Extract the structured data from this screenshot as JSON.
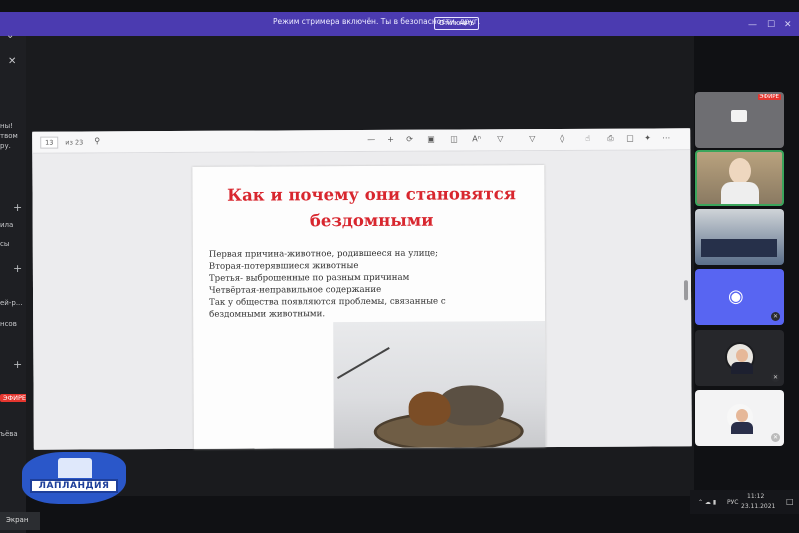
{
  "banner": {
    "text": "Режим стримера включён. Ты в безопасности, друг.",
    "disable_button": "Отключить"
  },
  "window_controls": {
    "minimize": "—",
    "maximize": "☐",
    "close": "✕"
  },
  "sidebar": {
    "chevron": "⌄",
    "close": "✕",
    "fragments": [
      "ны!",
      "твом",
      "ру.",
      "ила",
      "сы",
      "ей-р...",
      "нсов",
      "ъёва"
    ],
    "add": "+",
    "live_badge": "ЭФИРЕ",
    "screen_button": "Экран"
  },
  "pdf_viewer": {
    "page_current": "13",
    "page_total": "из 23",
    "toolbar_icons": [
      "search-icon",
      "zoom-out-icon",
      "zoom-in-icon",
      "rotate-icon",
      "fit-page-icon",
      "page-view-icon",
      "read-aloud-icon",
      "draw-icon",
      "highlight-icon",
      "erase-icon",
      "print-icon",
      "save-icon",
      "pin-icon"
    ]
  },
  "slide": {
    "title_line1": "Как и почему они становятся",
    "title_line2": "бездомными",
    "lines": [
      "Первая причина-животное, родившееся на улице;",
      "Вторая-потерявшиеся животные",
      "Третья- выброшенные по разным причинам",
      "Четвёртая-неправильное содержание",
      "Так у общества появляются проблемы, связанные с",
      "бездомными животными."
    ]
  },
  "participants": {
    "live_badge": "ЭФИРЕ"
  },
  "taskbar": {
    "lang": "РУС",
    "time": "11:12",
    "date": "23.11.2021"
  },
  "logo": {
    "text": "ЛАПЛАНДИЯ"
  },
  "colors": {
    "banner": "#4b3bb0",
    "title_red": "#d8262e",
    "live": "#e5362f",
    "logo_blue": "#2a57c9"
  }
}
